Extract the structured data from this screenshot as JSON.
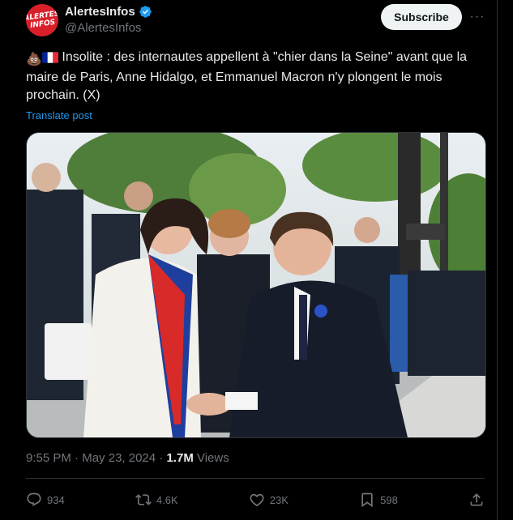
{
  "author": {
    "display_name": "AlertesInfos",
    "handle": "@AlertesInfos",
    "avatar_text_line1": "ALERTES",
    "avatar_text_line2": "INFOS",
    "verified_icon": "verified-badge-icon"
  },
  "header": {
    "subscribe_label": "Subscribe",
    "more_label": "···"
  },
  "tweet": {
    "emoji_1": "💩",
    "emoji_2": "🇫🇷",
    "text": "Insolite : des internautes appellent à \"chier dans la Seine\" avant que la maire de Paris, Anne Hidalgo, et Emmanuel Macron n'y plongent le mois prochain. (X)",
    "translate_label": "Translate post"
  },
  "meta": {
    "time": "9:55 PM",
    "separator": " · ",
    "date": "May 23, 2024",
    "views_count": "1.7M",
    "views_label": " Views"
  },
  "actions": {
    "replies": "934",
    "reposts": "4.6K",
    "likes": "23K",
    "bookmarks": "598"
  },
  "colors": {
    "background": "#000000",
    "text": "#e7e9ea",
    "muted": "#71767b",
    "link": "#1d9bf0",
    "avatar": "#d9202a"
  }
}
